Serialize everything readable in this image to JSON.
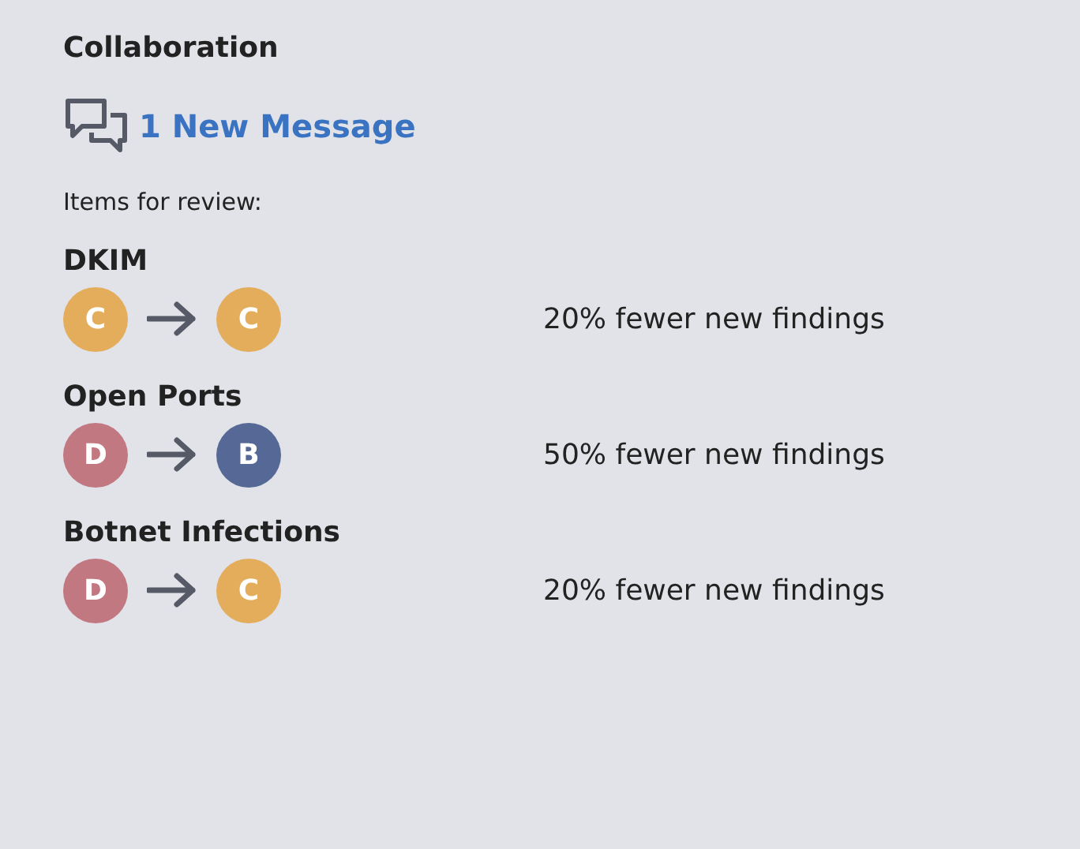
{
  "section_title": "Collaboration",
  "message_link": "1 New Message",
  "review_label": "Items for review:",
  "items": [
    {
      "name": "DKIM",
      "from": {
        "grade": "C",
        "color": "#e3ad5c"
      },
      "to": {
        "grade": "C",
        "color": "#e3ad5c"
      },
      "change": "20% fewer new findings"
    },
    {
      "name": "Open Ports",
      "from": {
        "grade": "D",
        "color": "#c27880"
      },
      "to": {
        "grade": "B",
        "color": "#566895"
      },
      "change": "50% fewer new findings"
    },
    {
      "name": "Botnet Infections",
      "from": {
        "grade": "D",
        "color": "#c27880"
      },
      "to": {
        "grade": "C",
        "color": "#e3ad5c"
      },
      "change": "20% fewer new findings"
    }
  ]
}
